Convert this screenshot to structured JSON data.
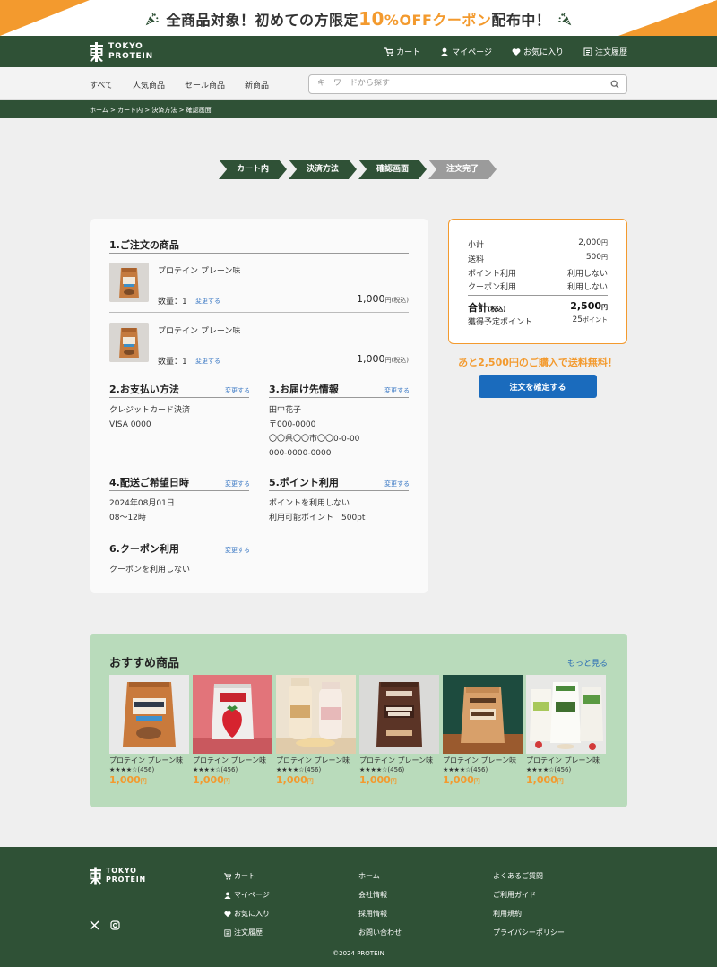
{
  "promo": {
    "part1": "全商品対象！初めての方限定",
    "highlight_num": "10",
    "highlight_off": "%OFF",
    "highlight_coupon": "クーポン",
    "part2": "配布中！",
    "accent_color": "#f39a2e",
    "icon": "party-popper-icon"
  },
  "header": {
    "logo_line1": "TOKYO",
    "logo_line2": "PROTEIN",
    "nav": [
      {
        "label": "カート",
        "icon": "cart-icon"
      },
      {
        "label": "マイページ",
        "icon": "user-icon"
      },
      {
        "label": "お気に入り",
        "icon": "heart-icon"
      },
      {
        "label": "注文履歴",
        "icon": "list-icon"
      }
    ],
    "bg_color": "#2f5136"
  },
  "subnav": {
    "categories": [
      "すべて",
      "人気商品",
      "セール商品",
      "新商品"
    ],
    "search_placeholder": "キーワードから探す"
  },
  "breadcrumb": "ホーム > カート内 > 決済方法 > 確認画面",
  "steps": [
    {
      "label": "カート内",
      "state": "active"
    },
    {
      "label": "決済方法",
      "state": "active"
    },
    {
      "label": "確認画面",
      "state": "active"
    },
    {
      "label": "注文完了",
      "state": "inactive"
    }
  ],
  "order": {
    "items_title": "1.ご注文の商品",
    "items": [
      {
        "name": "プロテイン プレーン味",
        "qty": "数量：1",
        "change": "変更する",
        "price": "1,000",
        "price_unit": "円(税込)"
      },
      {
        "name": "プロテイン プレーン味",
        "qty": "数量：1",
        "change": "変更する",
        "price": "1,000",
        "price_unit": "円(税込)"
      }
    ],
    "change_label": "変更する",
    "payment": {
      "title": "2.お支払い方法",
      "line1": "クレジットカード決済",
      "line2": "VISA 0000"
    },
    "shipping": {
      "title": "3.お届け先情報",
      "line1": "田中花子",
      "line2": "〒000-0000",
      "line3": "〇〇県〇〇市〇〇0-0-00",
      "line4": "000-0000-0000"
    },
    "delivery": {
      "title": "4.配送ご希望日時",
      "line1": "2024年08月01日",
      "line2": "08〜12時"
    },
    "points": {
      "title": "5.ポイント利用",
      "line1": "ポイントを利用しない",
      "line2": "利用可能ポイント　500pt"
    },
    "coupon": {
      "title": "6.クーポン利用",
      "line1": "クーポンを利用しない"
    }
  },
  "summary": {
    "subtotal_label": "小計",
    "subtotal": "2,000",
    "subtotal_unit": "円",
    "shipping_label": "送料",
    "shipping": "500",
    "shipping_unit": "円",
    "point_label": "ポイント利用",
    "point": "利用しない",
    "coupon_label": "クーポン利用",
    "coupon": "利用しない",
    "total_label": "合計",
    "total_tax": "(税込)",
    "total": "2,500",
    "total_unit": "円",
    "earn_label": "獲得予定ポイント",
    "earn": "25",
    "earn_unit": "ポイント",
    "free_shipping": "あと2,500円のご購入で送料無料！",
    "confirm_button": "注文を確定する",
    "border_color": "#f39a2e",
    "button_color": "#1a6bbd"
  },
  "recommend": {
    "title": "おすすめ商品",
    "more": "もっと見る",
    "bg_color": "#b9dbbb",
    "products": [
      {
        "name": "プロテイン プレーン味",
        "stars": "★★★★☆",
        "reviews": "(456)",
        "price": "1,000",
        "unit": "円",
        "image": "orange-protein-bag"
      },
      {
        "name": "プロテイン プレーン味",
        "stars": "★★★★☆",
        "reviews": "(456)",
        "price": "1,000",
        "unit": "円",
        "image": "strawberry-pouch"
      },
      {
        "name": "プロテイン プレーン味",
        "stars": "★★★★☆",
        "reviews": "(456)",
        "price": "1,000",
        "unit": "円",
        "image": "protein-bottles"
      },
      {
        "name": "プロテイン プレーン味",
        "stars": "★★★★☆",
        "reviews": "(456)",
        "price": "1,000",
        "unit": "円",
        "image": "dark-protein-bag"
      },
      {
        "name": "プロテイン プレーン味",
        "stars": "★★★★☆",
        "reviews": "(456)",
        "price": "1,000",
        "unit": "円",
        "image": "plain-protein-bag"
      },
      {
        "name": "プロテイン プレーン味",
        "stars": "★★★★☆",
        "reviews": "(456)",
        "price": "1,000",
        "unit": "円",
        "image": "protein-packages"
      }
    ]
  },
  "footer": {
    "logo_line1": "TOKYO",
    "logo_line2": "PROTEIN",
    "col1": [
      {
        "label": "カート",
        "icon": "cart-icon"
      },
      {
        "label": "マイページ",
        "icon": "user-icon"
      },
      {
        "label": "お気に入り",
        "icon": "heart-icon"
      },
      {
        "label": "注文履歴",
        "icon": "list-icon"
      }
    ],
    "col2": [
      "ホーム",
      "会社情報",
      "採用情報",
      "お問い合わせ"
    ],
    "col3": [
      "よくあるご質問",
      "ご利用ガイド",
      "利用規約",
      "プライバシーポリシー"
    ],
    "copyright": "©2024 PROTEIN"
  }
}
